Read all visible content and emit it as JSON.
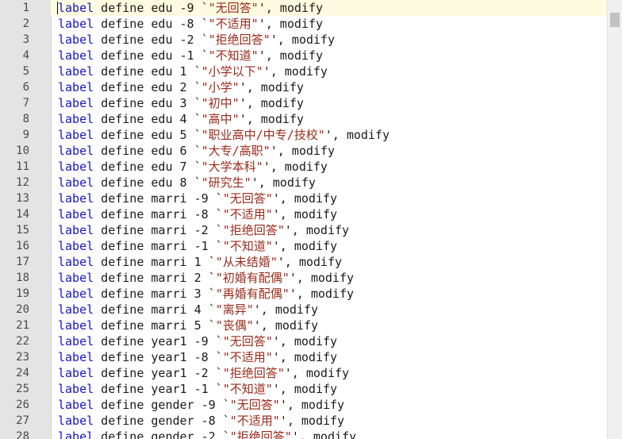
{
  "editor": {
    "colors": {
      "keyword": "#1515c8",
      "text": "#1a1a1a",
      "string": "#9b2a1a",
      "current_line_bg": "#fdfce0",
      "gutter_bg": "#e4e4e4"
    },
    "lines": [
      {
        "n": "1",
        "kw": "label",
        "rest": " define edu -9 `",
        "str": "\"无回答\"",
        "tail": "', modify"
      },
      {
        "n": "2",
        "kw": "label",
        "rest": " define edu -8 `",
        "str": "\"不适用\"",
        "tail": "', modify"
      },
      {
        "n": "3",
        "kw": "label",
        "rest": " define edu -2 `",
        "str": "\"拒绝回答\"",
        "tail": "', modify"
      },
      {
        "n": "4",
        "kw": "label",
        "rest": " define edu -1 `",
        "str": "\"不知道\"",
        "tail": "', modify"
      },
      {
        "n": "5",
        "kw": "label",
        "rest": " define edu 1 `",
        "str": "\"小学以下\"",
        "tail": "', modify"
      },
      {
        "n": "6",
        "kw": "label",
        "rest": " define edu 2 `",
        "str": "\"小学\"",
        "tail": "', modify"
      },
      {
        "n": "7",
        "kw": "label",
        "rest": " define edu 3 `",
        "str": "\"初中\"",
        "tail": "', modify"
      },
      {
        "n": "8",
        "kw": "label",
        "rest": " define edu 4 `",
        "str": "\"高中\"",
        "tail": "', modify"
      },
      {
        "n": "9",
        "kw": "label",
        "rest": " define edu 5 `",
        "str": "\"职业高中/中专/技校\"",
        "tail": "', modify"
      },
      {
        "n": "10",
        "kw": "label",
        "rest": " define edu 6 `",
        "str": "\"大专/高职\"",
        "tail": "', modify"
      },
      {
        "n": "11",
        "kw": "label",
        "rest": " define edu 7 `",
        "str": "\"大学本科\"",
        "tail": "', modify"
      },
      {
        "n": "12",
        "kw": "label",
        "rest": " define edu 8 `",
        "str": "\"研究生\"",
        "tail": "', modify"
      },
      {
        "n": "13",
        "kw": "label",
        "rest": " define marri -9 `",
        "str": "\"无回答\"",
        "tail": "', modify"
      },
      {
        "n": "14",
        "kw": "label",
        "rest": " define marri -8 `",
        "str": "\"不适用\"",
        "tail": "', modify"
      },
      {
        "n": "15",
        "kw": "label",
        "rest": " define marri -2 `",
        "str": "\"拒绝回答\"",
        "tail": "', modify"
      },
      {
        "n": "16",
        "kw": "label",
        "rest": " define marri -1 `",
        "str": "\"不知道\"",
        "tail": "', modify"
      },
      {
        "n": "17",
        "kw": "label",
        "rest": " define marri 1 `",
        "str": "\"从未结婚\"",
        "tail": "', modify"
      },
      {
        "n": "18",
        "kw": "label",
        "rest": " define marri 2 `",
        "str": "\"初婚有配偶\"",
        "tail": "', modify"
      },
      {
        "n": "19",
        "kw": "label",
        "rest": " define marri 3 `",
        "str": "\"再婚有配偶\"",
        "tail": "', modify"
      },
      {
        "n": "20",
        "kw": "label",
        "rest": " define marri 4 `",
        "str": "\"离异\"",
        "tail": "', modify"
      },
      {
        "n": "21",
        "kw": "label",
        "rest": " define marri 5 `",
        "str": "\"丧偶\"",
        "tail": "', modify"
      },
      {
        "n": "22",
        "kw": "label",
        "rest": " define year1 -9 `",
        "str": "\"无回答\"",
        "tail": "', modify"
      },
      {
        "n": "23",
        "kw": "label",
        "rest": " define year1 -8 `",
        "str": "\"不适用\"",
        "tail": "', modify"
      },
      {
        "n": "24",
        "kw": "label",
        "rest": " define year1 -2 `",
        "str": "\"拒绝回答\"",
        "tail": "', modify"
      },
      {
        "n": "25",
        "kw": "label",
        "rest": " define year1 -1 `",
        "str": "\"不知道\"",
        "tail": "', modify"
      },
      {
        "n": "26",
        "kw": "label",
        "rest": " define gender -9 `",
        "str": "\"无回答\"",
        "tail": "', modify"
      },
      {
        "n": "27",
        "kw": "label",
        "rest": " define gender -8 `",
        "str": "\"不适用\"",
        "tail": "', modify"
      },
      {
        "n": "28",
        "kw": "label",
        "rest": " define gender -2 `",
        "str": "\"拒绝回答\"",
        "tail": "', modify"
      }
    ]
  }
}
